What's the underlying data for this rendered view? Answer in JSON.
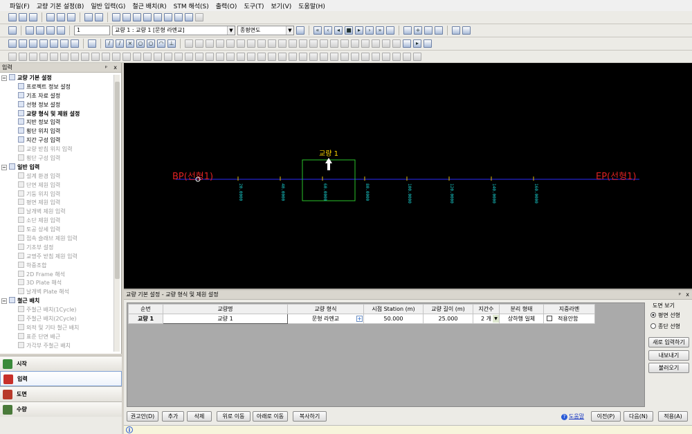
{
  "menu": [
    "파일(F)",
    "교량 기본 설정(B)",
    "일반 입력(G)",
    "철근 배치(R)",
    "STM 해석(S)",
    "출력(O)",
    "도구(T)",
    "보기(V)",
    "도움말(H)"
  ],
  "toolbar2": {
    "stage": "1",
    "bridge_select": "교량 1 : 교량 1 [문형 라멘교]",
    "view_select": "종평면도"
  },
  "left_panel": {
    "title": "입력",
    "pin": "ᵖ",
    "close": "x",
    "sections": [
      {
        "label": "교량 기본 설정",
        "items": [
          {
            "label": "프로젝트 정보 설정",
            "enabled": true
          },
          {
            "label": "기초 자료 설정",
            "enabled": true
          },
          {
            "label": "선형 정보 설정",
            "enabled": true
          },
          {
            "label": "교량 형식 및 제원 설정",
            "enabled": true,
            "bold": true
          },
          {
            "label": "지반 정보 입력",
            "enabled": true
          },
          {
            "label": "횡단 위치 입력",
            "enabled": true
          },
          {
            "label": "지간 구성 입력",
            "enabled": true
          },
          {
            "label": "교량 받침 위치 입력",
            "enabled": false
          },
          {
            "label": "횡단 구성 입력",
            "enabled": false
          }
        ]
      },
      {
        "label": "일반 입력",
        "items": [
          {
            "label": "설계 환경 입력",
            "enabled": false
          },
          {
            "label": "단면 제원 입력",
            "enabled": false
          },
          {
            "label": "기둥 위치 입력",
            "enabled": false
          },
          {
            "label": "평면 제원 입력",
            "enabled": false
          },
          {
            "label": "날개벽 제원 입력",
            "enabled": false
          },
          {
            "label": "소단 제원 입력",
            "enabled": false
          },
          {
            "label": "토공 상세 입력",
            "enabled": false
          },
          {
            "label": "접속 슬래브 제원 입력",
            "enabled": false
          },
          {
            "label": "기초부 설정",
            "enabled": false
          },
          {
            "label": "교명주 받침 제원 입력",
            "enabled": false
          },
          {
            "label": "하중조합",
            "enabled": false
          },
          {
            "label": "2D Frame 해석",
            "enabled": false
          },
          {
            "label": "3D Plate 해석",
            "enabled": false
          },
          {
            "label": "날개벽 Plate 해석",
            "enabled": false
          }
        ]
      },
      {
        "label": "철근 배치",
        "items": [
          {
            "label": "주철근 배치(1Cycle)",
            "enabled": false
          },
          {
            "label": "주철근 배치(2Cycle)",
            "enabled": false
          },
          {
            "label": "외적 및 기타 철근 배치",
            "enabled": false
          },
          {
            "label": "표준 단면 배근",
            "enabled": false
          },
          {
            "label": "가각부 주철근 배치",
            "enabled": false
          }
        ]
      }
    ],
    "nav": [
      {
        "label": "시작",
        "color": "#3a8a3a"
      },
      {
        "label": "입력",
        "color": "#c8302a"
      },
      {
        "label": "도면",
        "color": "#b83a2a"
      },
      {
        "label": "수량",
        "color": "#4a7a3a"
      }
    ]
  },
  "canvas": {
    "bp_label": "BP(선형1)",
    "ep_label": "EP(선형1)",
    "bridge_label": "교량 1",
    "stations": [
      "20.0000",
      "40.0000",
      "60.0000",
      "80.0000",
      "100.0000",
      "120.0000",
      "140.0000",
      "160.0000"
    ]
  },
  "bottom_panel": {
    "title": "교량 기본 설정 - 교량 형식 및 제원 설정",
    "pin": "ᵖ",
    "close": "x",
    "columns": [
      "순번",
      "교량명",
      "교량 형식",
      "시점 Station (m)",
      "교량 길이 (m)",
      "지간수",
      "분리 형태",
      "지중라멘"
    ],
    "rows": [
      {
        "no": "교량 1",
        "name": "교량 1",
        "type": "문형 라멘교",
        "station": "50.000",
        "length": "25.000",
        "spans": "2 개",
        "separation": "상하행 일체",
        "underground": "적용안함"
      }
    ],
    "view_group": "도면 보기",
    "view_options": [
      "평면 선형",
      "종단 선형"
    ],
    "side_buttons": [
      "새로 입력하기",
      "내보내기",
      "불러오기"
    ],
    "buttons": [
      "권고안(D)",
      "추가",
      "삭제",
      "위로 이동",
      "아래로 이동",
      "복사하기"
    ],
    "help": "도움말",
    "prev": "이전(P)",
    "next": "다음(N)",
    "apply": "적용(A)"
  },
  "status": {
    "info_icon": "i"
  }
}
